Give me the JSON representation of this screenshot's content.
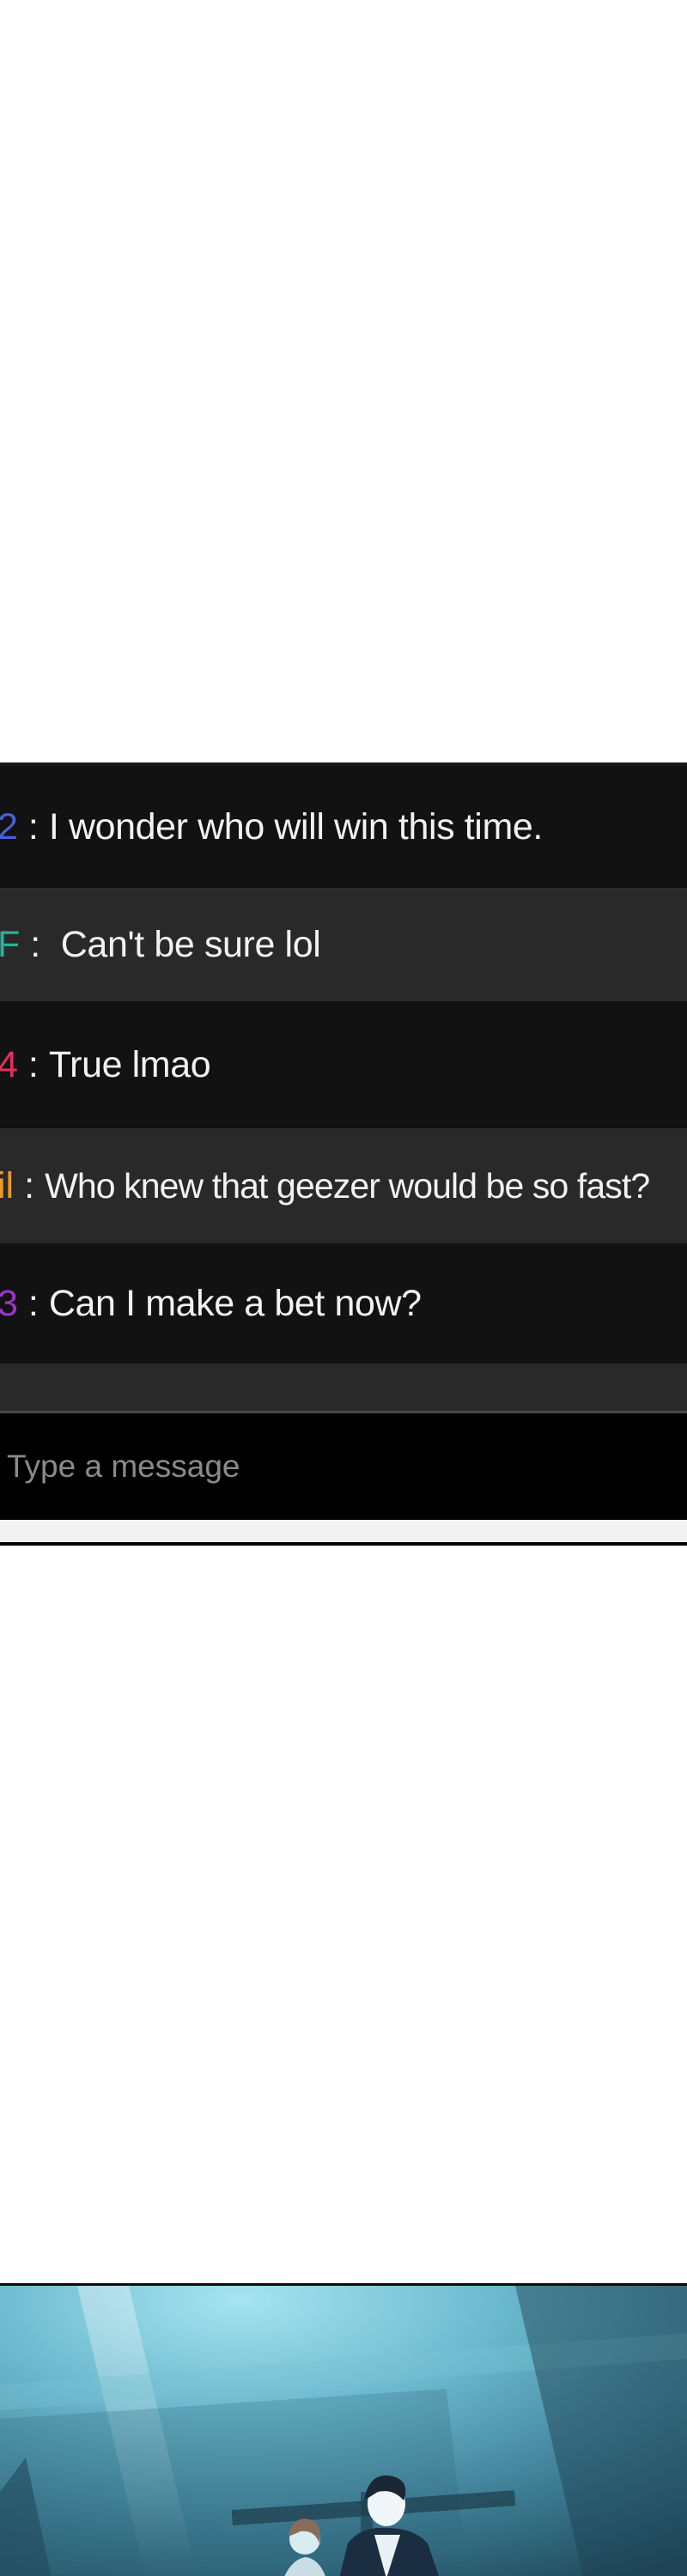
{
  "chat": {
    "messages": [
      {
        "user": "2",
        "user_color": "#4a5fd8",
        "separator": ":",
        "text": "I wonder who will win this time."
      },
      {
        "user": "F",
        "user_color": "#23b39a",
        "separator": ":",
        "text": " Can't be sure lol"
      },
      {
        "user": "4",
        "user_color": "#e5305c",
        "separator": ":",
        "text": "True lmao"
      },
      {
        "user": "il",
        "user_color": "#e89a2a",
        "separator": ":",
        "text": "Who knew that geezer would be so fast?"
      },
      {
        "user": "3",
        "user_color": "#9b34c9",
        "separator": ":",
        "text": "Can I make a bet now?"
      }
    ],
    "input_placeholder": "Type a message"
  },
  "colors": {
    "chat_background": "#111111",
    "chat_row_alt": "#292929",
    "input_background": "#000000"
  }
}
